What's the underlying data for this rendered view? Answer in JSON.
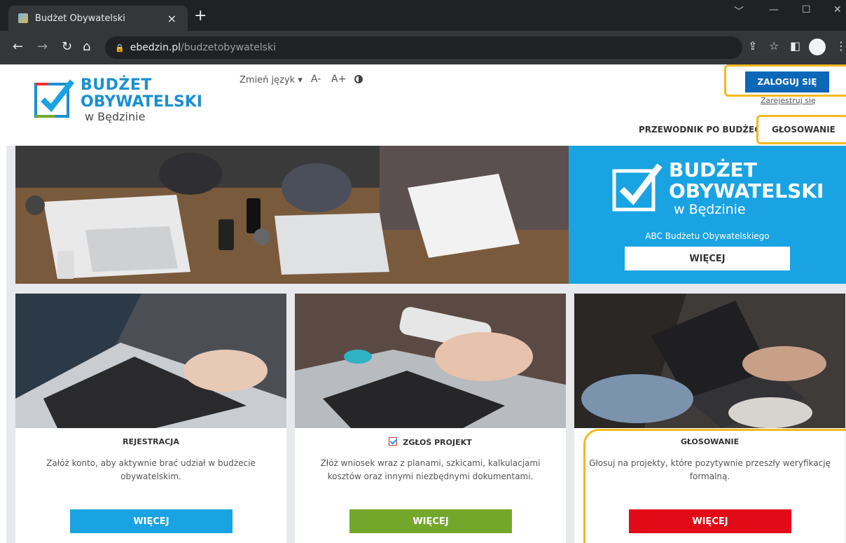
{
  "browser": {
    "tab_title": "Budżet Obywatelski",
    "tab_close": "×",
    "new_tab": "+",
    "url_host": "ebedzin.pl",
    "url_path": "/budzetobywatelski",
    "icons": [
      "back-icon",
      "forward-icon",
      "reload-icon",
      "home-icon",
      "lock-icon",
      "share-icon",
      "star-icon",
      "sidepanel-icon",
      "profile-icon",
      "menu-icon"
    ]
  },
  "header": {
    "logo_line1": "BUDŻET",
    "logo_line2": "OBYWATELSKI",
    "logo_line3": "w Będzinie",
    "language_label": "Zmień język ▾",
    "font_decrease": "A-",
    "font_increase": "A+",
    "login_button": "ZALOGUJ SIĘ",
    "register_link": "Zarejestruj się",
    "nav": [
      "PRZEWODNIK PO BUDŻECIE",
      "GŁOSOWANIE"
    ]
  },
  "hero": {
    "logo_line1": "BUDŻET",
    "logo_line2": "OBYWATELSKI",
    "logo_line3": "w Będzinie",
    "subtitle": "ABC Budżetu Obywatelskiego",
    "button": "WIĘCEJ"
  },
  "cards": [
    {
      "title": "REJESTRACJA",
      "desc": "Załóż konto, aby aktywnie brać udział w budżecie obywatelskim.",
      "button": "WIĘCEJ",
      "color": "#1aa3e2"
    },
    {
      "title": "ZGŁOŚ PROJEKT",
      "desc": "Złóż wniosek wraz z planami, szkicami, kalkulacjami kosztów oraz innymi niezbędnymi dokumentami.",
      "button": "WIĘCEJ",
      "color": "#73a72b"
    },
    {
      "title": "GŁOSOWANIE",
      "desc": "Głosuj na projekty, które pozytywnie przeszły weryfikację formalną.",
      "button": "WIĘCEJ",
      "color": "#e30a17"
    }
  ],
  "colors": {
    "accent_blue": "#1aa3e2",
    "login_blue": "#0b67b7",
    "highlight": "#f3b81e"
  }
}
